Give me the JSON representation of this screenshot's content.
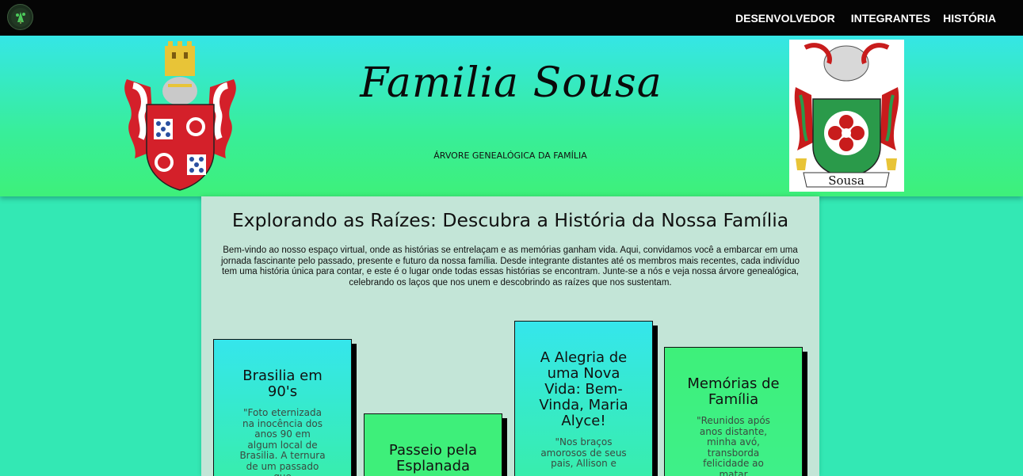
{
  "nav": {
    "items": [
      {
        "label": "DESENVOLVEDOR"
      },
      {
        "label": "INTEGRANTES"
      },
      {
        "label": "HISTÓRIA"
      }
    ]
  },
  "hero": {
    "title": "Familia Sousa",
    "subtitle": "ÁRVORE GENEALÓGICA DA FAMÍLIA",
    "crest_right_label": "Sousa"
  },
  "main": {
    "heading": "Explorando as Raízes: Descubra a História da Nossa Família",
    "intro": "Bem-vindo ao nosso espaço virtual, onde as histórias se entrelaçam e as memórias ganham vida. Aqui, convidamos você a embarcar em uma jornada fascinante pelo passado, presente e futuro da nossa família. Desde integrante distantes até os membros mais recentes, cada indivíduo tem uma história única para contar, e este é o lugar onde todas essas histórias se encontram. Junte-se a nós e veja nossa árvore genealógica, celebrando os laços que nos unem e descobrindo as raízes que nos sustentam.",
    "cards": [
      {
        "title": "Brasilia em 90's",
        "desc": "\"Foto eternizada na inocência dos anos 90 em algum local de Brasilia. A ternura de um passado que"
      },
      {
        "title": "Passeio pela Esplanada",
        "desc": ""
      },
      {
        "title": "A Alegria de uma Nova Vida: Bem-Vinda, Maria Alyce!",
        "desc": "\"Nos braços amorosos de seus pais, Allison e"
      },
      {
        "title": "Memórias de Família",
        "desc": "\"Reunidos após anos distante, minha avó, transborda felicidade ao matar"
      }
    ]
  }
}
